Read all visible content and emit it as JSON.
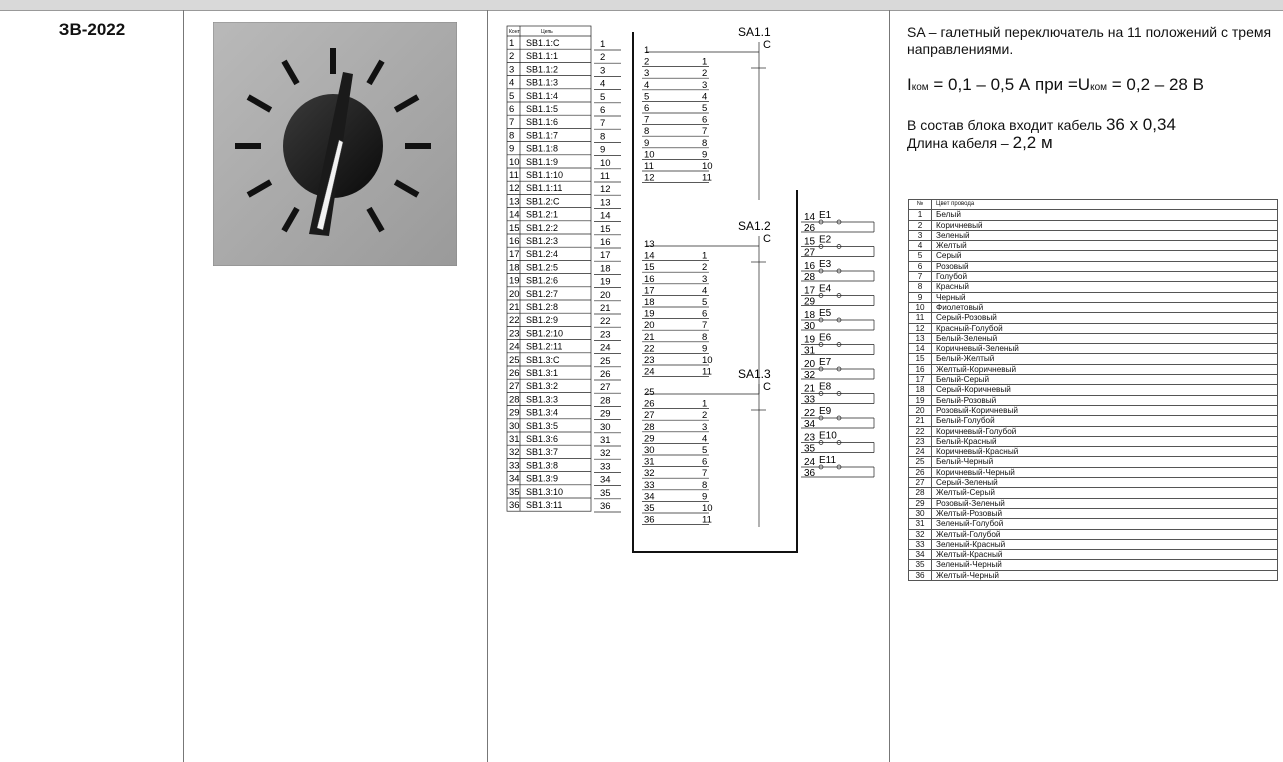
{
  "model": "ЗВ-2022",
  "description": {
    "line1": "SA – галетный переключатель на 11 положений с тремя направлениями.",
    "current_i": "I",
    "current_sub": "ком",
    "current_mid": " = 0,1 – 0,5 А при =U",
    "current_sub2": "ком",
    "current_end": " = 0,2 – 28 В",
    "cable_text": "В состав блока входит кабель ",
    "cable_spec": "36 х 0,34",
    "length_text": "Длина кабеля – ",
    "length_value": "2,2 м"
  },
  "schematic": {
    "hdr_contact": "Конт",
    "hdr_circuit": "Цепь",
    "contacts": [
      {
        "n": "1",
        "c": "SB1.1:C"
      },
      {
        "n": "2",
        "c": "SB1.1:1"
      },
      {
        "n": "3",
        "c": "SB1.1:2"
      },
      {
        "n": "4",
        "c": "SB1.1:3"
      },
      {
        "n": "5",
        "c": "SB1.1:4"
      },
      {
        "n": "6",
        "c": "SB1.1:5"
      },
      {
        "n": "7",
        "c": "SB1.1:6"
      },
      {
        "n": "8",
        "c": "SB1.1:7"
      },
      {
        "n": "9",
        "c": "SB1.1:8"
      },
      {
        "n": "10",
        "c": "SB1.1:9"
      },
      {
        "n": "11",
        "c": "SB1.1:10"
      },
      {
        "n": "12",
        "c": "SB1.1:11"
      },
      {
        "n": "13",
        "c": "SB1.2:C"
      },
      {
        "n": "14",
        "c": "SB1.2:1"
      },
      {
        "n": "15",
        "c": "SB1.2:2"
      },
      {
        "n": "16",
        "c": "SB1.2:3"
      },
      {
        "n": "17",
        "c": "SB1.2:4"
      },
      {
        "n": "18",
        "c": "SB1.2:5"
      },
      {
        "n": "19",
        "c": "SB1.2:6"
      },
      {
        "n": "20",
        "c": "SB1.2:7"
      },
      {
        "n": "21",
        "c": "SB1.2:8"
      },
      {
        "n": "22",
        "c": "SB1.2:9"
      },
      {
        "n": "23",
        "c": "SB1.2:10"
      },
      {
        "n": "24",
        "c": "SB1.2:11"
      },
      {
        "n": "25",
        "c": "SB1.3:C"
      },
      {
        "n": "26",
        "c": "SB1.3:1"
      },
      {
        "n": "27",
        "c": "SB1.3:2"
      },
      {
        "n": "28",
        "c": "SB1.3:3"
      },
      {
        "n": "29",
        "c": "SB1.3:4"
      },
      {
        "n": "30",
        "c": "SB1.3:5"
      },
      {
        "n": "31",
        "c": "SB1.3:6"
      },
      {
        "n": "32",
        "c": "SB1.3:7"
      },
      {
        "n": "33",
        "c": "SB1.3:8"
      },
      {
        "n": "34",
        "c": "SB1.3:9"
      },
      {
        "n": "35",
        "c": "SB1.3:10"
      },
      {
        "n": "36",
        "c": "SB1.3:11"
      }
    ],
    "switches": [
      {
        "label": "SA1.1",
        "common": "C",
        "pins": [
          "1",
          "2",
          "3",
          "4",
          "5",
          "6",
          "7",
          "8",
          "9",
          "10",
          "11",
          "12"
        ]
      },
      {
        "label": "SA1.2",
        "common": "C",
        "pins": [
          "13",
          "14",
          "15",
          "16",
          "17",
          "18",
          "19",
          "20",
          "21",
          "22",
          "23",
          "24"
        ]
      },
      {
        "label": "SA1.3",
        "common": "C",
        "pins": [
          "25",
          "26",
          "27",
          "28",
          "29",
          "30",
          "31",
          "32",
          "33",
          "34",
          "35",
          "36"
        ]
      }
    ],
    "position_numbers": [
      "1",
      "2",
      "3",
      "4",
      "5",
      "6",
      "7",
      "8",
      "9",
      "10",
      "11"
    ],
    "lamps": [
      {
        "label": "E1",
        "top": "14",
        "bottom": "26"
      },
      {
        "label": "E2",
        "top": "15",
        "bottom": "27"
      },
      {
        "label": "E3",
        "top": "16",
        "bottom": "28"
      },
      {
        "label": "E4",
        "top": "17",
        "bottom": "29"
      },
      {
        "label": "E5",
        "top": "18",
        "bottom": "30"
      },
      {
        "label": "E6",
        "top": "19",
        "bottom": "31"
      },
      {
        "label": "E7",
        "top": "20",
        "bottom": "32"
      },
      {
        "label": "E8",
        "top": "21",
        "bottom": "33"
      },
      {
        "label": "E9",
        "top": "22",
        "bottom": "34"
      },
      {
        "label": "E10",
        "top": "23",
        "bottom": "35"
      },
      {
        "label": "E11",
        "top": "24",
        "bottom": "36"
      }
    ]
  },
  "wire_table": {
    "header": [
      "№",
      "Цвет провода"
    ],
    "rows": [
      [
        "1",
        "Белый"
      ],
      [
        "2",
        "Коричневый"
      ],
      [
        "3",
        "Зеленый"
      ],
      [
        "4",
        "Желтый"
      ],
      [
        "5",
        "Серый"
      ],
      [
        "6",
        "Розовый"
      ],
      [
        "7",
        "Голубой"
      ],
      [
        "8",
        "Красный"
      ],
      [
        "9",
        "Черный"
      ],
      [
        "10",
        "Фиолетовый"
      ],
      [
        "11",
        "Серый-Розовый"
      ],
      [
        "12",
        "Красный-Голубой"
      ],
      [
        "13",
        "Белый-Зеленый"
      ],
      [
        "14",
        "Коричневый-Зеленый"
      ],
      [
        "15",
        "Белый-Желтый"
      ],
      [
        "16",
        "Желтый-Коричневый"
      ],
      [
        "17",
        "Белый-Серый"
      ],
      [
        "18",
        "Серый-Коричневый"
      ],
      [
        "19",
        "Белый-Розовый"
      ],
      [
        "20",
        "Розовый-Коричневый"
      ],
      [
        "21",
        "Белый-Голубой"
      ],
      [
        "22",
        "Коричневый-Голубой"
      ],
      [
        "23",
        "Белый-Красный"
      ],
      [
        "24",
        "Коричневый-Красный"
      ],
      [
        "25",
        "Белый-Черный"
      ],
      [
        "26",
        "Коричневый-Черный"
      ],
      [
        "27",
        "Серый-Зеленый"
      ],
      [
        "28",
        "Желтый-Серый"
      ],
      [
        "29",
        "Розовый-Зеленый"
      ],
      [
        "30",
        "Желтый-Розовый"
      ],
      [
        "31",
        "Зеленый-Голубой"
      ],
      [
        "32",
        "Желтый-Голубой"
      ],
      [
        "33",
        "Зеленый-Красный"
      ],
      [
        "34",
        "Желтый-Красный"
      ],
      [
        "35",
        "Зеленый-Черный"
      ],
      [
        "36",
        "Желтый-Черный"
      ]
    ]
  }
}
